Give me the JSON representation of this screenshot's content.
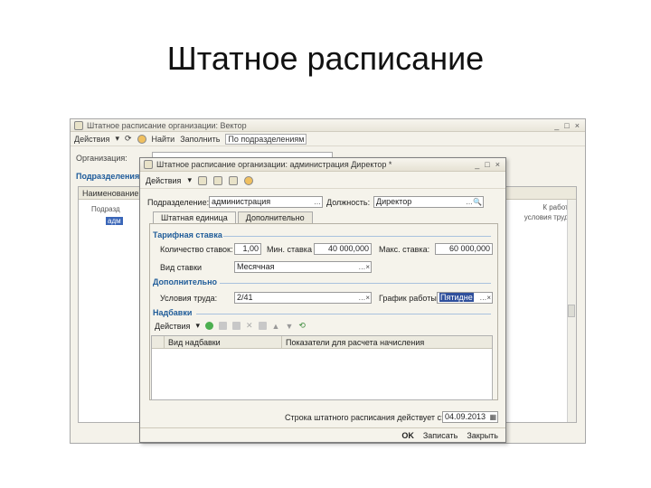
{
  "slide": {
    "title": "Штатное расписание"
  },
  "bg_window": {
    "title": "Штатное расписание организации: Вектор",
    "toolbar": {
      "actions": "Действия",
      "find": "Найти",
      "fill": "Заполнить",
      "filter": "По подразделениям"
    },
    "org_label": "Организация:",
    "subdiv_label": "Подразделения",
    "list_header": "Наименование",
    "tree_item1": "Подразд",
    "tree_item2": "адм",
    "right_col1": "К работе",
    "right_col2": "условия труда"
  },
  "dialog": {
    "title": "Штатное расписание организации: администрация Директор *",
    "toolbar": {
      "actions": "Действия"
    },
    "subdivision_label": "Подразделение:",
    "subdivision_value": "администрация",
    "position_label": "Должность:",
    "position_value": "Директор",
    "tabs": [
      "Штатная единица",
      "Дополнительно"
    ],
    "tariff_section": "Тарифная ставка",
    "qty_label": "Количество ставок:",
    "qty_value": "1,00",
    "min_label": "Мин. ставка",
    "min_value": "40 000,000",
    "max_label": "Макс. ставка:",
    "max_value": "60 000,000",
    "kind_label": "Вид ставки",
    "kind_value": "Месячная",
    "extra_section": "Дополнительно",
    "conditions_label": "Условия труда:",
    "conditions_value": "2/41",
    "schedule_label": "График работы:",
    "schedule_value": "Пятидне",
    "bonus_section": "Надбавки",
    "bonus_actions": "Действия",
    "grid_col1": "Вид надбавки",
    "grid_col2": "Показатели для расчета начисления",
    "date_label": "Строка штатного расписания действует с:",
    "date_value": "04.09.2013",
    "ok": "OK",
    "write": "Записать",
    "close": "Закрыть"
  }
}
